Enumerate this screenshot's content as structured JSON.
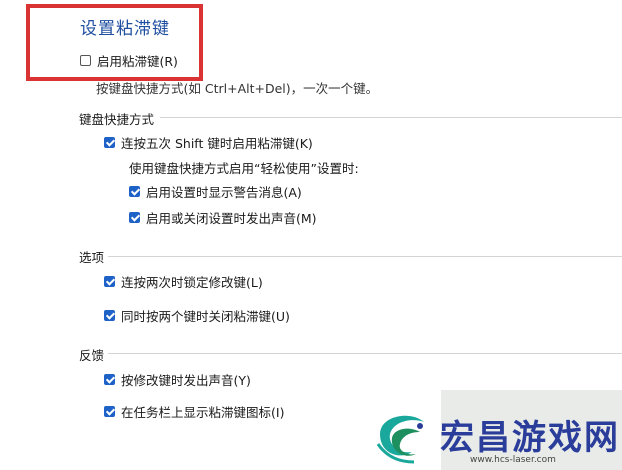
{
  "header": {
    "title": "设置粘滞键"
  },
  "sticky_main": {
    "label": "启用粘滞键(R)",
    "checked": false
  },
  "description": "按键盘快捷方式(如 Ctrl+Alt+Del)，一次一个键。",
  "sections": {
    "shortcut": {
      "title": "键盘快捷方式",
      "press_shift": "连按五次 Shift 键时启用粘滞键(K)",
      "sub_heading": "使用键盘快捷方式启用“轻松使用”设置时:",
      "show_warning": "启用设置时显示警告消息(A)",
      "play_sound": "启用或关闭设置时发出声音(M)"
    },
    "options": {
      "title": "选项",
      "lock_modifier": "连按两次时锁定修改键(L)",
      "turn_off_two_keys": "同时按两个键时关闭粘滞键(U)"
    },
    "feedback": {
      "title": "反馈",
      "sound_modifier": "按修改键时发出声音(Y)",
      "show_taskbar_icon": "在任务栏上显示粘滞键图标(I)"
    }
  },
  "watermark": {
    "text": "宏昌游戏网",
    "url": "www.hcs-laser.com"
  },
  "colors": {
    "accent": "#1e62c8",
    "highlight": "#d93333",
    "title": "#1f4fa0"
  }
}
